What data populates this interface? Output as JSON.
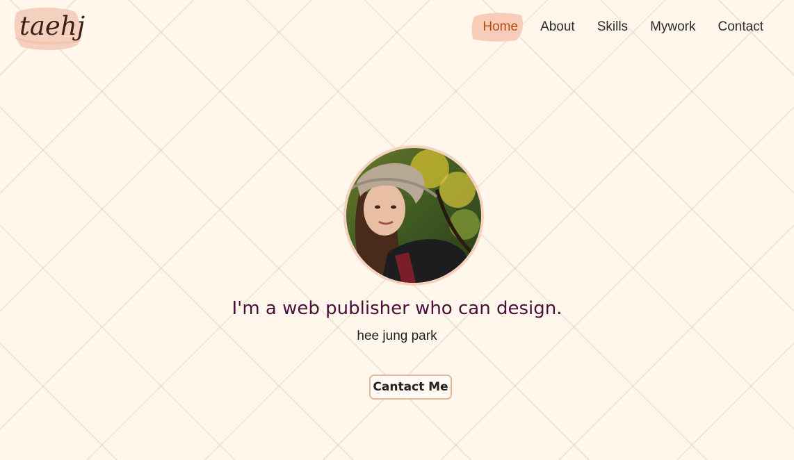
{
  "header": {
    "logo_text": "taehj",
    "nav": [
      {
        "label": "Home",
        "active": true
      },
      {
        "label": "About",
        "active": false
      },
      {
        "label": "Skills",
        "active": false
      },
      {
        "label": "Mywork",
        "active": false
      },
      {
        "label": "Contact",
        "active": false
      }
    ]
  },
  "hero": {
    "headline": "I'm a web publisher who can design.",
    "name": "hee jung park",
    "cta_label": "Cantact Me"
  },
  "colors": {
    "background": "#fff6ec",
    "accent_blob": "#f7cdb9",
    "active_nav": "#b44a14",
    "headline": "#4a103c",
    "avatar_border": "#f5d2bd",
    "button_border": "#e3b894"
  },
  "icons": {
    "avatar": "profile-photo"
  }
}
